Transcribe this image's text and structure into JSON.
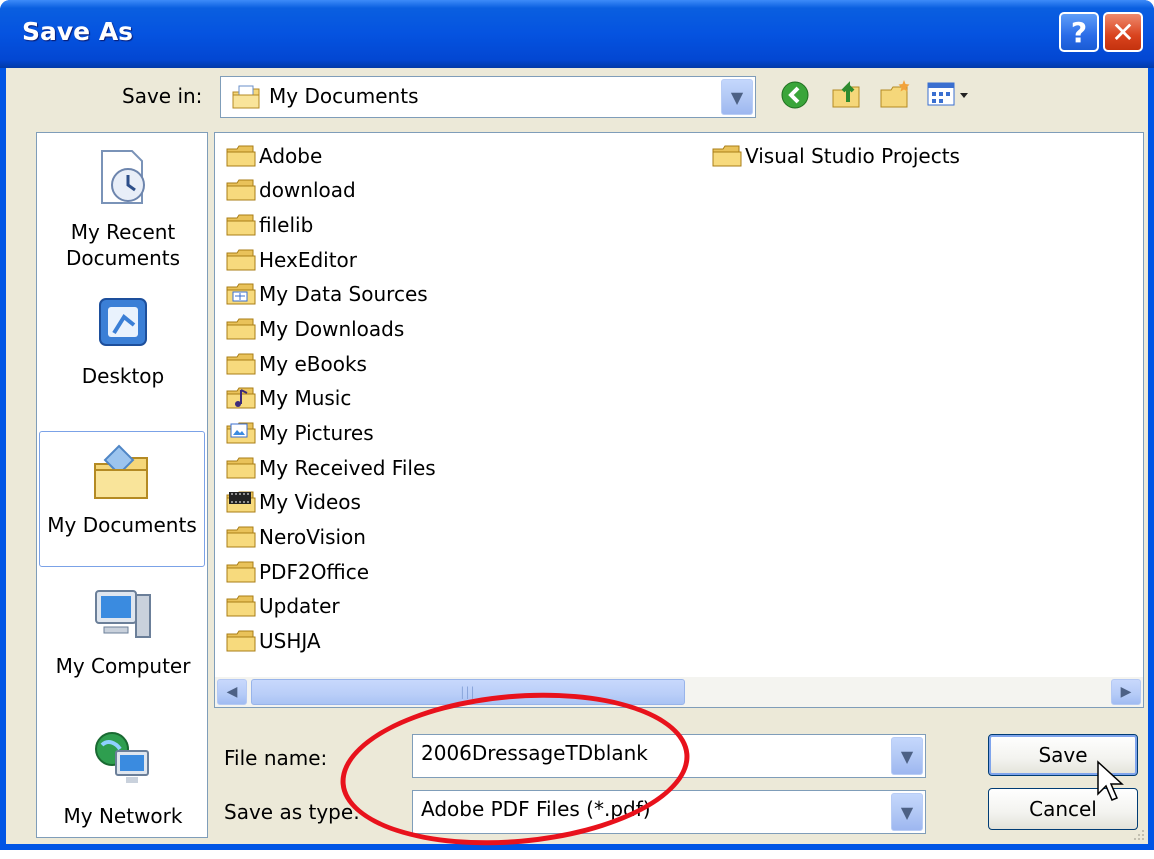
{
  "window": {
    "title": "Save As",
    "help_label": "?",
    "close_label": "✕"
  },
  "toolbar": {
    "save_in_label": "Save in:",
    "location_value": "My Documents"
  },
  "places": [
    {
      "line1": "My Recent",
      "line2": "Documents",
      "icon": "recent-documents-icon"
    },
    {
      "line1": "Desktop",
      "line2": "",
      "icon": "desktop-icon"
    },
    {
      "line1": "My Documents",
      "line2": "",
      "icon": "my-documents-icon"
    },
    {
      "line1": "My Computer",
      "line2": "",
      "icon": "computer-icon"
    },
    {
      "line1": "My Network",
      "line2": "",
      "icon": "network-icon"
    }
  ],
  "files": [
    {
      "name": "Adobe",
      "icon": "folder-icon"
    },
    {
      "name": "download",
      "icon": "folder-icon"
    },
    {
      "name": "filelib",
      "icon": "folder-icon"
    },
    {
      "name": "HexEditor",
      "icon": "folder-icon"
    },
    {
      "name": "My Data Sources",
      "icon": "data-sources-folder-icon"
    },
    {
      "name": "My Downloads",
      "icon": "folder-icon"
    },
    {
      "name": "My eBooks",
      "icon": "folder-icon"
    },
    {
      "name": "My Music",
      "icon": "music-folder-icon"
    },
    {
      "name": "My Pictures",
      "icon": "pictures-folder-icon"
    },
    {
      "name": "My Received Files",
      "icon": "folder-icon"
    },
    {
      "name": "My Videos",
      "icon": "videos-folder-icon"
    },
    {
      "name": "NeroVision",
      "icon": "folder-icon"
    },
    {
      "name": "PDF2Office",
      "icon": "folder-icon"
    },
    {
      "name": "Updater",
      "icon": "folder-icon"
    },
    {
      "name": "USHJA",
      "icon": "folder-icon"
    },
    {
      "name": "Visual Studio Projects",
      "icon": "folder-icon"
    }
  ],
  "form": {
    "file_name_label": "File name:",
    "file_name_value": "2006DressageTDblank",
    "save_type_label": "Save as type:",
    "save_type_value": "Adobe PDF Files (*.pdf)"
  },
  "buttons": {
    "save": "Save",
    "cancel": "Cancel"
  },
  "colors": {
    "titlebar": "#0553e0",
    "client_bg": "#ece9d8",
    "annotation": "#e8121c"
  }
}
